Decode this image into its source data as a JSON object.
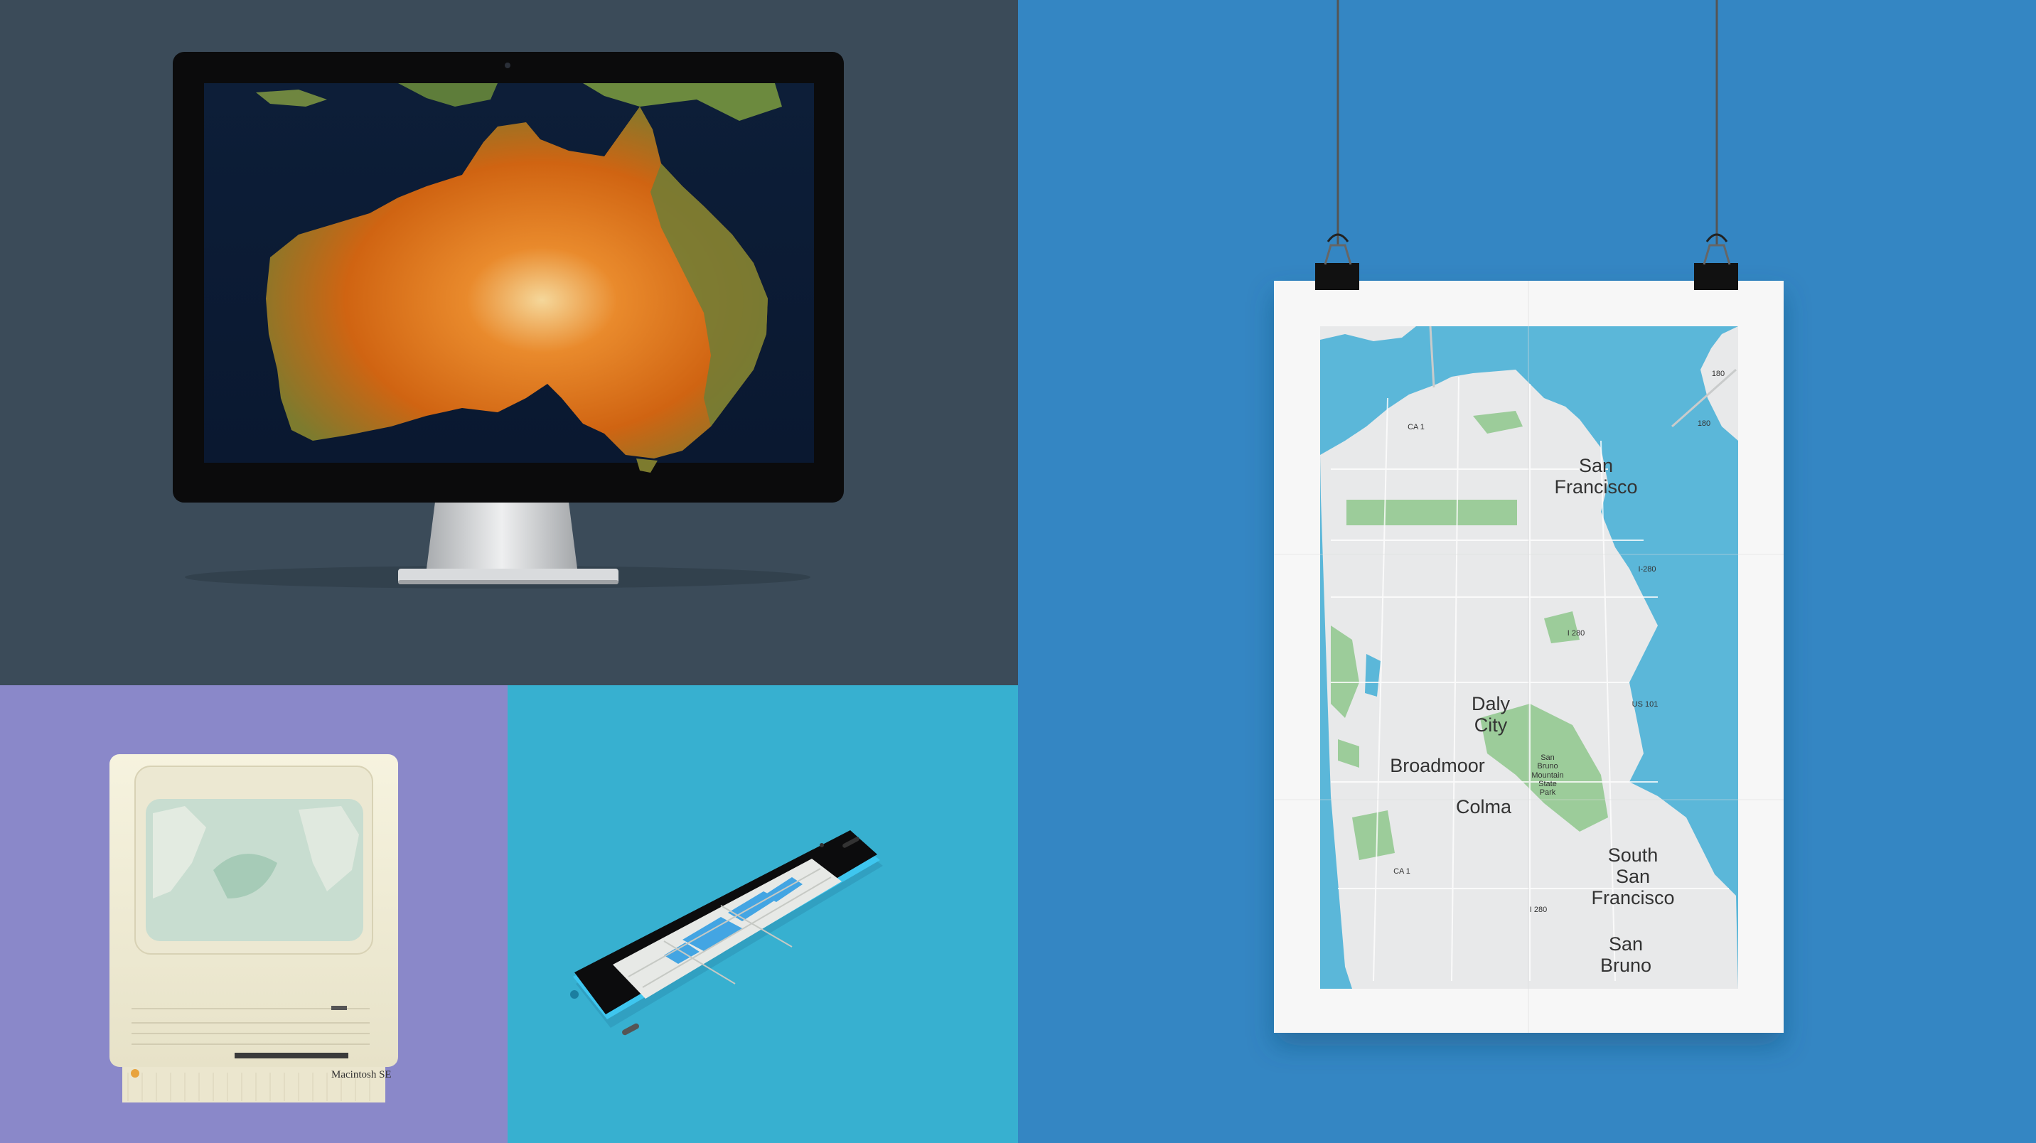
{
  "panels": {
    "monitor": {
      "bg": "#3b4b59",
      "subject": "satellite map of Australia"
    },
    "retro_computer": {
      "bg": "#8a88c9",
      "label": "Macintosh SE"
    },
    "phone": {
      "bg": "#37b0d0"
    },
    "poster": {
      "bg": "#3486c3"
    }
  },
  "poster_map": {
    "city_labels": {
      "sf_1": "San",
      "sf_2": "Francisco",
      "daly_1": "Daly",
      "daly_2": "City",
      "broadmoor": "Broadmoor",
      "colma": "Colma",
      "ssf_1": "South",
      "ssf_2": "San",
      "ssf_3": "Francisco",
      "sb_1": "San",
      "sb_2": "Bruno"
    },
    "park_labels": {
      "p1": "San",
      "p2": "Bruno",
      "p3": "Mountain",
      "p4": "State",
      "p5": "Park"
    },
    "shields": {
      "s1": "CA 1",
      "s2": "180",
      "s3": "I-280",
      "s4": "I 280",
      "s5": "US 101",
      "s6": "CA 1",
      "s7": "I 280",
      "s8": "180"
    },
    "colors": {
      "water": "#5bb7d9",
      "land": "#e8e9ea",
      "park": "#9ccc9a"
    }
  }
}
